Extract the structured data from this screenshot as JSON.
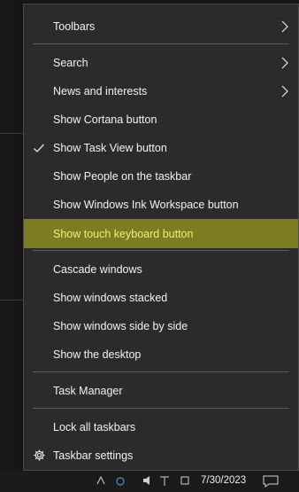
{
  "menu": {
    "items": [
      {
        "label": "Toolbars",
        "submenu": true
      },
      {
        "label": "Search",
        "submenu": true
      },
      {
        "label": "News and interests",
        "submenu": true
      },
      {
        "label": "Show Cortana button"
      },
      {
        "label": "Show Task View button",
        "checked": true
      },
      {
        "label": "Show People on the taskbar"
      },
      {
        "label": "Show Windows Ink Workspace button"
      },
      {
        "label": "Show touch keyboard button",
        "highlighted": true
      },
      {
        "label": "Cascade windows"
      },
      {
        "label": "Show windows stacked"
      },
      {
        "label": "Show windows side by side"
      },
      {
        "label": "Show the desktop"
      },
      {
        "label": "Task Manager"
      },
      {
        "label": "Lock all taskbars"
      },
      {
        "label": "Taskbar settings",
        "icon": "gear-icon"
      }
    ]
  },
  "taskbar": {
    "date": "7/30/2023"
  },
  "colors": {
    "menu_bg": "#2b2b2b",
    "highlight_bg": "#7c7c23",
    "highlight_text": "#f0ee7a",
    "separator": "#5a5a5a"
  }
}
